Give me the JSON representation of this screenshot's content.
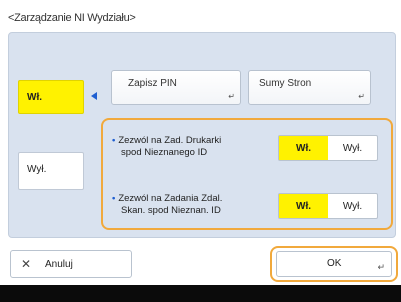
{
  "title": "<Zarządzanie NI Wydziału>",
  "left": {
    "on_label": "Wł.",
    "off_label": "Wył."
  },
  "top_buttons": [
    {
      "label": "Zapisz PIN"
    },
    {
      "label": "Sumy Stron"
    }
  ],
  "options": [
    {
      "line1": "Zezwól na Zad. Drukarki",
      "line2": "spod Nieznanego ID",
      "on": "Wł.",
      "off": "Wył."
    },
    {
      "line1": "Zezwól na Zadania Zdal.",
      "line2": "Skan. spod Nieznan. ID",
      "on": "Wł.",
      "off": "Wył."
    }
  ],
  "footer": {
    "cancel": "Anuluj",
    "ok": "OK"
  },
  "colors": {
    "selected": "#fff200",
    "focus": "#f1a93c",
    "panel": "#d9e2ef",
    "indicator": "#1f5fd1"
  },
  "icons": {
    "cancel": "close-icon",
    "ok": "return-icon",
    "submenu": "corner-arrow-icon",
    "pointer": "left-pointer-icon"
  }
}
